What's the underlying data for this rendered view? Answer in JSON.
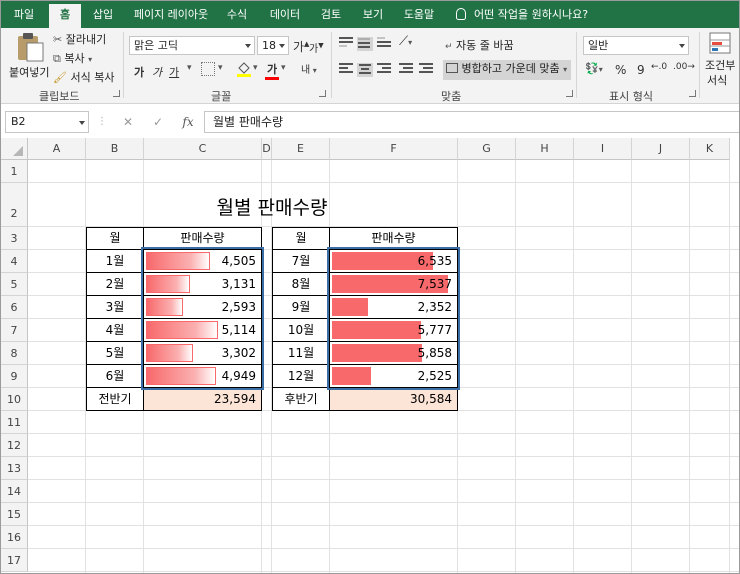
{
  "ribbon_tabs": [
    {
      "label": "파일",
      "active": false
    },
    {
      "label": "홈",
      "active": true
    },
    {
      "label": "삽입",
      "active": false
    },
    {
      "label": "페이지 레이아웃",
      "active": false
    },
    {
      "label": "수식",
      "active": false
    },
    {
      "label": "데이터",
      "active": false
    },
    {
      "label": "검토",
      "active": false
    },
    {
      "label": "보기",
      "active": false
    },
    {
      "label": "도움말",
      "active": false
    }
  ],
  "tell_me": "어떤 작업을 원하시나요?",
  "clipboard": {
    "paste": "붙여넣기",
    "cut": "잘라내기",
    "copy": "복사",
    "format_painter": "서식 복사",
    "group": "클립보드"
  },
  "font": {
    "name": "맑은 고딕",
    "size": "18",
    "increase": "가",
    "decrease": "가",
    "bold": "가",
    "italic": "가",
    "underline": "가",
    "font_color": "가",
    "phonetic": "내",
    "group": "글꼴"
  },
  "alignment": {
    "wrap_text": "자동 줄 바꿈",
    "merge_center": "병합하고 가운데 맞춤",
    "group": "맞춤"
  },
  "number": {
    "format": "일반",
    "percent": "%",
    "comma": "9",
    "group": "표시 형식"
  },
  "styles": {
    "conditional_line1": "조건부",
    "conditional_line2": "서식"
  },
  "formula_bar": {
    "name_box": "B2",
    "content": "월별 판매수량"
  },
  "columns": [
    "A",
    "B",
    "C",
    "D",
    "E",
    "F",
    "G",
    "H",
    "I",
    "J",
    "K"
  ],
  "rows": [
    "1",
    "2",
    "3",
    "4",
    "5",
    "6",
    "7",
    "8",
    "9",
    "10",
    "11",
    "12",
    "13",
    "14",
    "15",
    "16",
    "17"
  ],
  "sheet": {
    "title": "월별 판매수량",
    "header_month": "월",
    "header_qty": "판매수량",
    "first_half": [
      {
        "month": "1월",
        "qty": "4,505",
        "value": 4505
      },
      {
        "month": "2월",
        "qty": "3,131",
        "value": 3131
      },
      {
        "month": "3월",
        "qty": "2,593",
        "value": 2593
      },
      {
        "month": "4월",
        "qty": "5,114",
        "value": 5114
      },
      {
        "month": "5월",
        "qty": "3,302",
        "value": 3302
      },
      {
        "month": "6월",
        "qty": "4,949",
        "value": 4949
      }
    ],
    "first_half_total_label": "전반기",
    "first_half_total": "23,594",
    "second_half": [
      {
        "month": "7월",
        "qty": "6,535",
        "value": 6535
      },
      {
        "month": "8월",
        "qty": "7,537",
        "value": 7537
      },
      {
        "month": "9월",
        "qty": "2,352",
        "value": 2352
      },
      {
        "month": "10월",
        "qty": "5,777",
        "value": 5777
      },
      {
        "month": "11월",
        "qty": "5,858",
        "value": 5858
      },
      {
        "month": "12월",
        "qty": "2,525",
        "value": 2525
      }
    ],
    "second_half_total_label": "후반기",
    "second_half_total": "30,584"
  },
  "colors": {
    "ribbon_green": "#217346",
    "databar_red": "#f8696b",
    "total_fill": "#fce4d6",
    "selection_blue": "#3a6ea5"
  }
}
